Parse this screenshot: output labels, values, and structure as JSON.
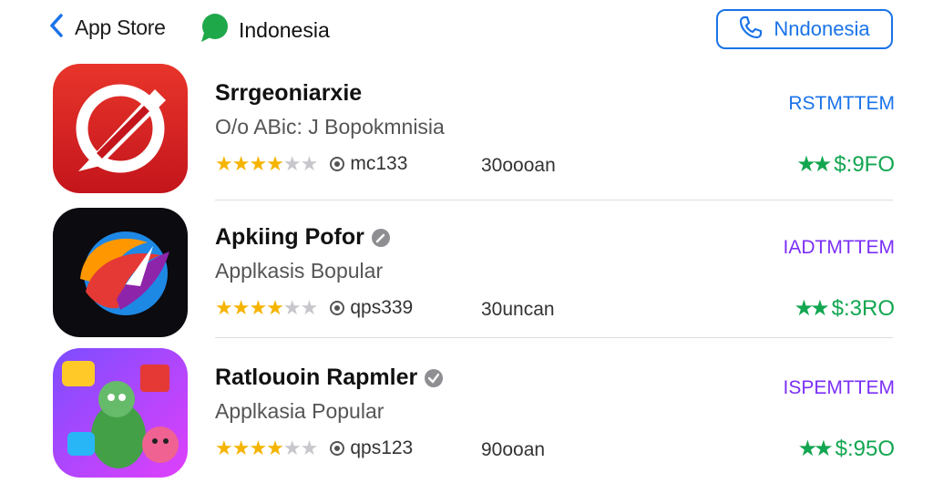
{
  "header": {
    "back_label": "App Store",
    "region_label": "Indonesia",
    "region_button_label": "Nndonesia"
  },
  "colors": {
    "accent_blue": "#1a73e8",
    "star_gold": "#f5b400",
    "price_green": "#12a650",
    "category_blue": "#1a73e8",
    "category_purple": "#7b2ff7"
  },
  "apps": [
    {
      "name": "Srrgeoniarxie",
      "subtitle": "O/o ABic: J Bopokmnisia",
      "rating_stars": 3.5,
      "downloads": "mc133",
      "size": "30oooan",
      "category": "RSTMTTEM",
      "price": "$:9FO",
      "icon": "red-circle-slash-icon"
    },
    {
      "name": "Apkiing Pofor",
      "subtitle": "Applkasis  Bopular",
      "rating_stars": 3.5,
      "downloads": "qps339",
      "size": "30uncan",
      "category": "IADTMTTEM",
      "price": "$:3RO",
      "icon": "colorful-swirl-icon"
    },
    {
      "name": "Ratlouoin Rapmler",
      "subtitle": "Applkasia  Popular",
      "rating_stars": 3.5,
      "downloads": "qps123",
      "size": "90ooan",
      "category": "ISPEMTTEM",
      "price": "$:95O",
      "icon": "cartoon-characters-icon"
    }
  ]
}
